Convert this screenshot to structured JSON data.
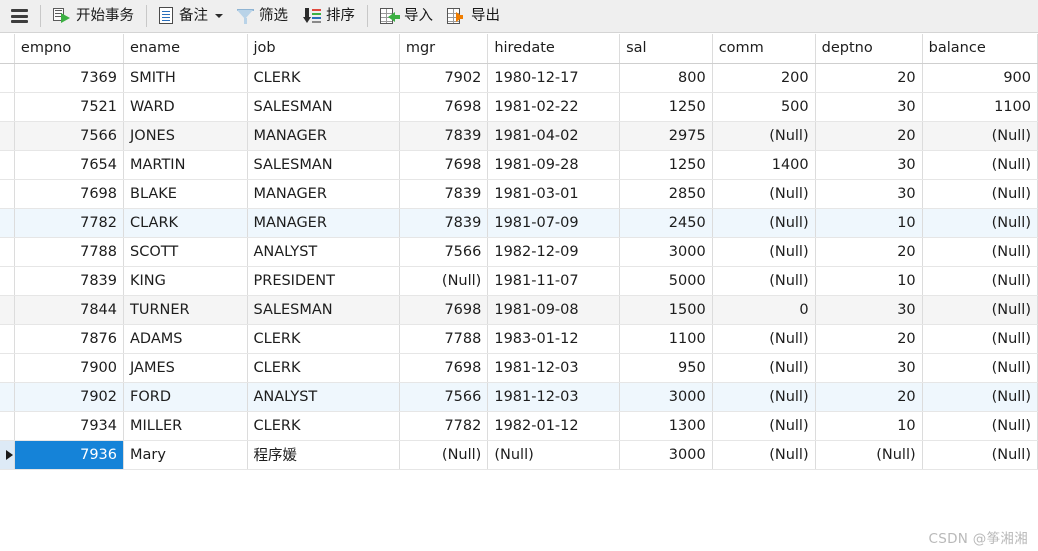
{
  "toolbar": {
    "menu_icon": "hamburger-icon",
    "buttons": [
      {
        "id": "begin-transaction",
        "label": "开始事务",
        "icon": "transaction-icon",
        "has_caret": false
      },
      {
        "id": "memo",
        "label": "备注",
        "icon": "note-icon",
        "has_caret": true
      },
      {
        "id": "filter",
        "label": "筛选",
        "icon": "filter-icon",
        "has_caret": false
      },
      {
        "id": "sort",
        "label": "排序",
        "icon": "sort-icon",
        "has_caret": false
      },
      {
        "id": "import",
        "label": "导入",
        "icon": "import-icon",
        "has_caret": false
      },
      {
        "id": "export",
        "label": "导出",
        "icon": "export-icon",
        "has_caret": false
      }
    ]
  },
  "grid": {
    "null_text": "(Null)",
    "active_column": "empno",
    "columns": [
      {
        "key": "empno",
        "label": "empno",
        "align": "right"
      },
      {
        "key": "ename",
        "label": "ename",
        "align": "left"
      },
      {
        "key": "job",
        "label": "job",
        "align": "left"
      },
      {
        "key": "mgr",
        "label": "mgr",
        "align": "right"
      },
      {
        "key": "hiredate",
        "label": "hiredate",
        "align": "left"
      },
      {
        "key": "sal",
        "label": "sal",
        "align": "right"
      },
      {
        "key": "comm",
        "label": "comm",
        "align": "right"
      },
      {
        "key": "deptno",
        "label": "deptno",
        "align": "right"
      },
      {
        "key": "balance",
        "label": "balance",
        "align": "right"
      }
    ],
    "rows": [
      {
        "empno": "7369",
        "ename": "SMITH",
        "job": "CLERK",
        "mgr": "7902",
        "hiredate": "1980-12-17",
        "sal": "800",
        "comm": "200",
        "deptno": "20",
        "balance": "900",
        "stripe": "none"
      },
      {
        "empno": "7521",
        "ename": "WARD",
        "job": "SALESMAN",
        "mgr": "7698",
        "hiredate": "1981-02-22",
        "sal": "1250",
        "comm": "500",
        "deptno": "30",
        "balance": "1100",
        "stripe": "none"
      },
      {
        "empno": "7566",
        "ename": "JONES",
        "job": "MANAGER",
        "mgr": "7839",
        "hiredate": "1981-04-02",
        "sal": "2975",
        "comm": "(Null)",
        "deptno": "20",
        "balance": "(Null)",
        "stripe": "gray"
      },
      {
        "empno": "7654",
        "ename": "MARTIN",
        "job": "SALESMAN",
        "mgr": "7698",
        "hiredate": "1981-09-28",
        "sal": "1250",
        "comm": "1400",
        "deptno": "30",
        "balance": "(Null)",
        "stripe": "none"
      },
      {
        "empno": "7698",
        "ename": "BLAKE",
        "job": "MANAGER",
        "mgr": "7839",
        "hiredate": "1981-03-01",
        "sal": "2850",
        "comm": "(Null)",
        "deptno": "30",
        "balance": "(Null)",
        "stripe": "none"
      },
      {
        "empno": "7782",
        "ename": "CLARK",
        "job": "MANAGER",
        "mgr": "7839",
        "hiredate": "1981-07-09",
        "sal": "2450",
        "comm": "(Null)",
        "deptno": "10",
        "balance": "(Null)",
        "stripe": "blue"
      },
      {
        "empno": "7788",
        "ename": "SCOTT",
        "job": "ANALYST",
        "mgr": "7566",
        "hiredate": "1982-12-09",
        "sal": "3000",
        "comm": "(Null)",
        "deptno": "20",
        "balance": "(Null)",
        "stripe": "none"
      },
      {
        "empno": "7839",
        "ename": "KING",
        "job": "PRESIDENT",
        "mgr": "(Null)",
        "hiredate": "1981-11-07",
        "sal": "5000",
        "comm": "(Null)",
        "deptno": "10",
        "balance": "(Null)",
        "stripe": "none"
      },
      {
        "empno": "7844",
        "ename": "TURNER",
        "job": "SALESMAN",
        "mgr": "7698",
        "hiredate": "1981-09-08",
        "sal": "1500",
        "comm": "0",
        "deptno": "30",
        "balance": "(Null)",
        "stripe": "gray"
      },
      {
        "empno": "7876",
        "ename": "ADAMS",
        "job": "CLERK",
        "mgr": "7788",
        "hiredate": "1983-01-12",
        "sal": "1100",
        "comm": "(Null)",
        "deptno": "20",
        "balance": "(Null)",
        "stripe": "none"
      },
      {
        "empno": "7900",
        "ename": "JAMES",
        "job": "CLERK",
        "mgr": "7698",
        "hiredate": "1981-12-03",
        "sal": "950",
        "comm": "(Null)",
        "deptno": "30",
        "balance": "(Null)",
        "stripe": "none"
      },
      {
        "empno": "7902",
        "ename": "FORD",
        "job": "ANALYST",
        "mgr": "7566",
        "hiredate": "1981-12-03",
        "sal": "3000",
        "comm": "(Null)",
        "deptno": "20",
        "balance": "(Null)",
        "stripe": "blue"
      },
      {
        "empno": "7934",
        "ename": "MILLER",
        "job": "CLERK",
        "mgr": "7782",
        "hiredate": "1982-01-12",
        "sal": "1300",
        "comm": "(Null)",
        "deptno": "10",
        "balance": "(Null)",
        "stripe": "none"
      },
      {
        "empno": "7936",
        "ename": "Mary",
        "job": "程序媛",
        "mgr": "(Null)",
        "hiredate": "(Null)",
        "sal": "3000",
        "comm": "(Null)",
        "deptno": "(Null)",
        "balance": "(Null)",
        "stripe": "none",
        "selected": true,
        "selected_cell": "empno"
      }
    ]
  },
  "watermark": {
    "text": "CSDN @筝湘湘"
  },
  "colors": {
    "selection": "#1583d8",
    "header_active": "#d6e9f8",
    "null_text": "#b6bac6",
    "toolbar_bg": "#efefef",
    "stripe_gray": "#f5f5f5",
    "stripe_blue": "#eff7fd"
  }
}
